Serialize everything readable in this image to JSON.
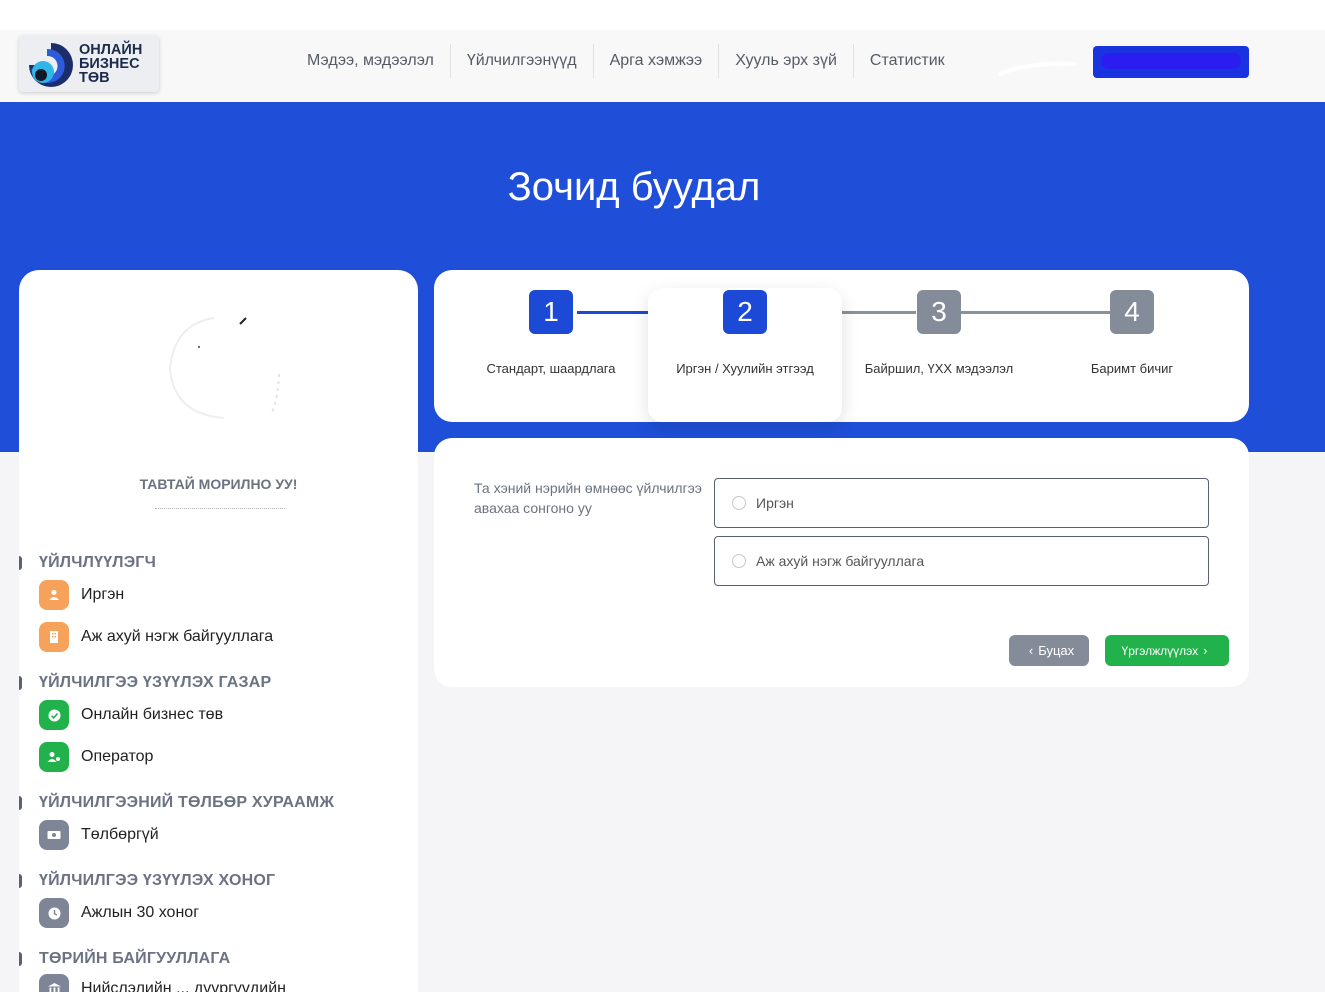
{
  "colors": {
    "brand_blue": "#1f4fd8",
    "step_done": "#1c4ad6",
    "step_pending": "#858c99",
    "success": "#22b24c",
    "orange": "#f6a25a"
  },
  "logo": {
    "line1": "ОНЛАЙН",
    "line2": "БИЗНЕС",
    "line3": "ТӨВ"
  },
  "nav": [
    {
      "label": "Мэдээ, мэдээлэл"
    },
    {
      "label": "Үйлчилгээнүүд"
    },
    {
      "label": "Арга хэмжээ"
    },
    {
      "label": "Хууль эрх зүй"
    },
    {
      "label": "Статистик"
    }
  ],
  "hero": {
    "title": "Зочид буудал"
  },
  "sidebar": {
    "welcome": "ТАВТАЙ МОРИЛНО УУ!",
    "sections": [
      {
        "title": "ҮЙЛЧЛҮҮЛЭГЧ",
        "items": [
          {
            "label": "Иргэн",
            "icon": "user-icon"
          },
          {
            "label": "Аж ахуй нэгж байгууллага",
            "icon": "building-icon"
          }
        ]
      },
      {
        "title": "ҮЙЛЧИЛГЭЭ ҮЗҮҮЛЭХ ГАЗАР",
        "items": [
          {
            "label": "Онлайн бизнес төв",
            "icon": "check-circle-icon"
          },
          {
            "label": "Оператор",
            "icon": "operator-icon"
          }
        ]
      },
      {
        "title": "ҮЙЛЧИЛГЭЭНИЙ ТӨЛБӨР ХУРААМЖ",
        "items": [
          {
            "label": "Төлбөргүй",
            "icon": "money-icon"
          }
        ]
      },
      {
        "title": "ҮЙЛЧИЛГЭЭ ҮЗҮҮЛЭХ ХОНОГ",
        "items": [
          {
            "label": "Ажлын 30 хоног",
            "icon": "clock-icon"
          }
        ]
      },
      {
        "title": "ТӨРИЙН БАЙГУУЛЛАГА",
        "items": [
          {
            "label": "Нийслэлийн ... дүүргүүдийн",
            "icon": "bank-icon"
          }
        ]
      }
    ]
  },
  "stepper": [
    {
      "num": "1",
      "label": "Стандарт, шаардлага",
      "state": "done"
    },
    {
      "num": "2",
      "label": "Иргэн / Хуулийн этгээд",
      "state": "active"
    },
    {
      "num": "3",
      "label": "Байршил, ҮХХ мэдээлэл",
      "state": "pending"
    },
    {
      "num": "4",
      "label": "Баримт бичиг",
      "state": "pending"
    }
  ],
  "form": {
    "question": "Та хэний нэрийн өмнөөс үйлчилгээ авахаа сонгоно уу",
    "options": [
      {
        "label": "Иргэн"
      },
      {
        "label": "Аж ахуй нэгж байгууллага"
      }
    ],
    "back_label": "Буцах",
    "next_label": "Үргэлжлүүлэх"
  }
}
